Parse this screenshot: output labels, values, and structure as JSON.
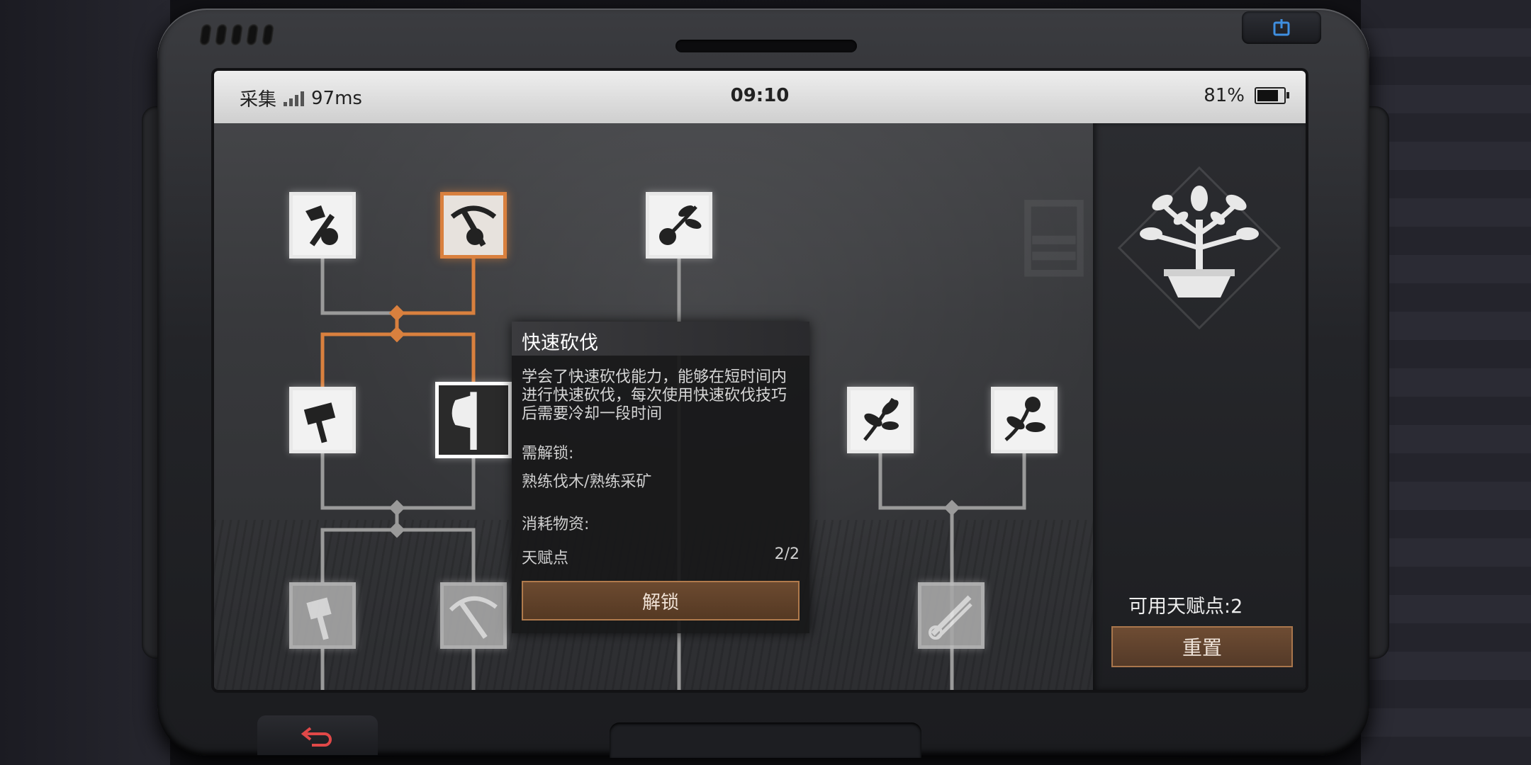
{
  "status_bar": {
    "mode": "采集",
    "ping": "97ms",
    "time": "09:10",
    "battery_percent": "81%",
    "battery_level": 0.81
  },
  "skill_tree": {
    "nodes": [
      {
        "id": "row1-a",
        "icon": "hand-axe-icon",
        "state": "unlocked"
      },
      {
        "id": "row1-b",
        "icon": "hand-pickaxe-icon",
        "state": "active"
      },
      {
        "id": "row1-c",
        "icon": "hand-herb-icon",
        "state": "unlocked"
      },
      {
        "id": "row2-a",
        "icon": "hammer-icon",
        "state": "unlocked"
      },
      {
        "id": "row2-b",
        "icon": "axe-icon",
        "state": "selected"
      },
      {
        "id": "row2-c",
        "icon": "plant-icon",
        "state": "unlocked"
      },
      {
        "id": "row2-d",
        "icon": "flower-icon",
        "state": "unlocked"
      },
      {
        "id": "row3-a",
        "icon": "sledgehammer-icon",
        "state": "locked"
      },
      {
        "id": "row3-b",
        "icon": "pickaxe-icon",
        "state": "locked"
      },
      {
        "id": "row3-c",
        "icon": "shears-icon",
        "state": "locked"
      }
    ]
  },
  "tooltip": {
    "title": "快速砍伐",
    "description": "学会了快速砍伐能力，能够在短时间内进行快速砍伐，每次使用快速砍伐技巧后需要冷却一段时间",
    "requirement_label": "需解锁:",
    "requirement": "熟练伐木/熟练采矿",
    "cost_label": "消耗物资:",
    "cost_item": "天赋点",
    "cost_value": "2/2",
    "unlock_label": "解锁"
  },
  "side_panel": {
    "emblem_icon": "tree-emblem-icon",
    "available_points": "可用天赋点:2",
    "reset_label": "重置"
  },
  "colors": {
    "accent_orange": "#d9803e",
    "button_brown": "#6c4a30"
  }
}
